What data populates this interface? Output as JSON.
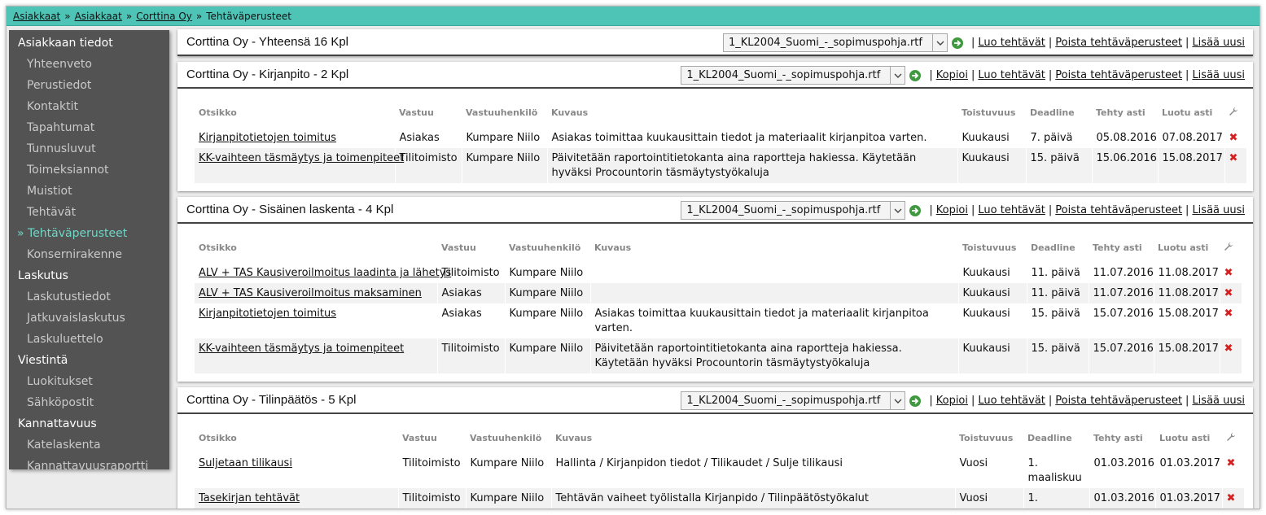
{
  "breadcrumb": [
    "Asiakkaat",
    "Asiakkaat",
    "Corttina Oy",
    "Tehtäväperusteet"
  ],
  "sidebar": [
    {
      "type": "head",
      "label": "Asiakkaan tiedot"
    },
    {
      "type": "item",
      "label": "Yhteenveto"
    },
    {
      "type": "item",
      "label": "Perustiedot"
    },
    {
      "type": "item",
      "label": "Kontaktit"
    },
    {
      "type": "item",
      "label": "Tapahtumat"
    },
    {
      "type": "item",
      "label": "Tunnusluvut"
    },
    {
      "type": "item",
      "label": "Toimeksiannot"
    },
    {
      "type": "item",
      "label": "Muistiot"
    },
    {
      "type": "item",
      "label": "Tehtävät"
    },
    {
      "type": "active",
      "label": "» Tehtäväperusteet"
    },
    {
      "type": "item",
      "label": "Konsernirakenne"
    },
    {
      "type": "head",
      "label": "Laskutus"
    },
    {
      "type": "item",
      "label": "Laskutustiedot"
    },
    {
      "type": "item",
      "label": "Jatkuvaislaskutus"
    },
    {
      "type": "item",
      "label": "Laskuluettelo"
    },
    {
      "type": "head",
      "label": "Viestintä"
    },
    {
      "type": "item",
      "label": "Luokitukset"
    },
    {
      "type": "item",
      "label": "Sähköpostit"
    },
    {
      "type": "head",
      "label": "Kannattavuus"
    },
    {
      "type": "item",
      "label": "Katelaskenta"
    },
    {
      "type": "item",
      "label": "Kannattavuusraportti"
    }
  ],
  "columns": [
    "Otsikko",
    "Vastuu",
    "Vastuuhenkilö",
    "Kuvaus",
    "Toistuvuus",
    "Deadline",
    "Tehty asti",
    "Luotu asti"
  ],
  "icons": {
    "go": "go-arrow-icon",
    "settings": "wrench-icon",
    "delete": "delete-x-icon",
    "dropdown": "chevron-down-icon"
  },
  "colors": {
    "topbar": "#4ec4b6",
    "sidebar": "#535353",
    "active": "#6fd6c6",
    "delete": "#d62020"
  },
  "summary": {
    "title": "Corttina Oy - Yhteensä 16 Kpl",
    "select": "1_KL2004_Suomi_-_sopimuspohja.rtf",
    "actions": [
      "Luo tehtävät",
      "Poista tehtäväperusteet",
      "Lisää uusi"
    ]
  },
  "groups": [
    {
      "title": "Corttina Oy - Kirjanpito - 2 Kpl",
      "select": "1_KL2004_Suomi_-_sopimuspohja.rtf",
      "actions": [
        "Kopioi",
        "Luo tehtävät",
        "Poista tehtäväperusteet",
        "Lisää uusi"
      ],
      "rows": [
        {
          "title": "Kirjanpitotietojen toimitus",
          "vastuu": "Asiakas",
          "henkilo": "Kumpare Niilo",
          "kuvaus": "Asiakas toimittaa kuukausittain tiedot ja materiaalit kirjanpitoa varten.",
          "toistuvuus": "Kuukausi",
          "deadline": "7. päivä",
          "tehty": "05.08.2016",
          "luotu": "07.08.2017"
        },
        {
          "title": "KK-vaihteen täsmäytys ja toimenpiteet",
          "vastuu": "Tilitoimisto",
          "henkilo": "Kumpare Niilo",
          "kuvaus": "Päivitetään raportointitietokanta aina raportteja hakiessa. Käytetään hyväksi Procountorin täsmäytystyökaluja",
          "toistuvuus": "Kuukausi",
          "deadline": "15. päivä",
          "tehty": "15.06.2016",
          "luotu": "15.08.2017"
        }
      ]
    },
    {
      "title": "Corttina Oy - Sisäinen laskenta - 4 Kpl",
      "select": "1_KL2004_Suomi_-_sopimuspohja.rtf",
      "actions": [
        "Kopioi",
        "Luo tehtävät",
        "Poista tehtäväperusteet",
        "Lisää uusi"
      ],
      "rows": [
        {
          "title": "ALV + TAS Kausiveroilmoitus laadinta ja lähetys",
          "vastuu": "Tilitoimisto",
          "henkilo": "Kumpare Niilo",
          "kuvaus": "",
          "toistuvuus": "Kuukausi",
          "deadline": "11. päivä",
          "tehty": "11.07.2016",
          "luotu": "11.08.2017"
        },
        {
          "title": "ALV + TAS Kausiveroilmoitus maksaminen",
          "vastuu": "Asiakas",
          "henkilo": "Kumpare Niilo",
          "kuvaus": "",
          "toistuvuus": "Kuukausi",
          "deadline": "11. päivä",
          "tehty": "11.07.2016",
          "luotu": "11.08.2017"
        },
        {
          "title": "Kirjanpitotietojen toimitus",
          "vastuu": "Asiakas",
          "henkilo": "Kumpare Niilo",
          "kuvaus": "Asiakas toimittaa kuukausittain tiedot ja materiaalit kirjanpitoa varten.",
          "toistuvuus": "Kuukausi",
          "deadline": "15. päivä",
          "tehty": "15.07.2016",
          "luotu": "15.08.2017"
        },
        {
          "title": "KK-vaihteen täsmäytys ja toimenpiteet",
          "vastuu": "Tilitoimisto",
          "henkilo": "Kumpare Niilo",
          "kuvaus": "Päivitetään raportointitietokanta aina raportteja hakiessa. Käytetään hyväksi Procountorin täsmäytystyökaluja",
          "toistuvuus": "Kuukausi",
          "deadline": "15. päivä",
          "tehty": "15.07.2016",
          "luotu": "15.08.2017"
        }
      ]
    },
    {
      "title": "Corttina Oy - Tilinpäätös - 5 Kpl",
      "select": "1_KL2004_Suomi_-_sopimuspohja.rtf",
      "actions": [
        "Kopioi",
        "Luo tehtävät",
        "Poista tehtäväperusteet",
        "Lisää uusi"
      ],
      "rows": [
        {
          "title": "Suljetaan tilikausi",
          "vastuu": "Tilitoimisto",
          "henkilo": "Kumpare Niilo",
          "kuvaus": "Hallinta / Kirjanpidon tiedot / Tilikaudet / Sulje tilikausi",
          "toistuvuus": "Vuosi",
          "deadline": "1. maaliskuu",
          "tehty": "01.03.2016",
          "luotu": "01.03.2017"
        },
        {
          "title": "Tasekirjan tehtävät",
          "vastuu": "Tilitoimisto",
          "henkilo": "Kumpare Niilo",
          "kuvaus": "Tehtävän vaiheet työlistalla Kirjanpido / Tilinpäätöstyökalut",
          "toistuvuus": "Vuosi",
          "deadline": "1.",
          "tehty": "01.03.2016",
          "luotu": "01.03.2017"
        }
      ]
    }
  ]
}
